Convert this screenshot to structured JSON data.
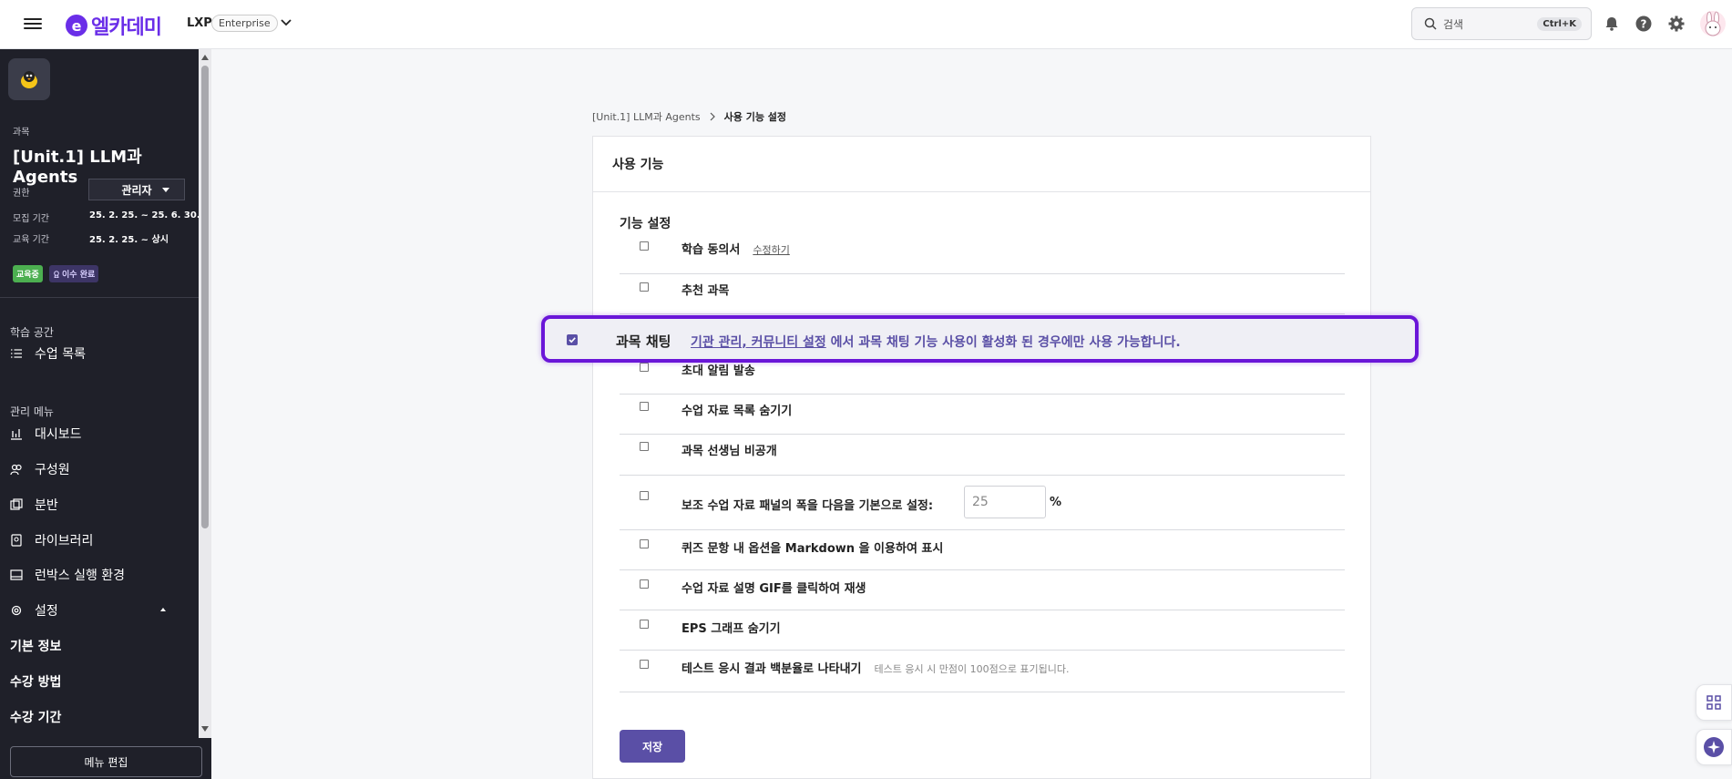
{
  "header": {
    "logo_text": "엘카데미",
    "logo_mark": "e",
    "product": "LXP",
    "edition": "Enterprise",
    "search_placeholder": "검색",
    "search_shortcut": "Ctrl+K",
    "icons": [
      "menu-icon",
      "chevron-down-icon",
      "search-icon",
      "bell-icon",
      "help-icon",
      "gear-icon",
      "user-avatar"
    ]
  },
  "sidebar": {
    "course_label": "과목",
    "course_title": "[Unit.1] LLM과 Agents",
    "role_label": "권한",
    "role_value": "관리자",
    "recruit_label": "모집 기간",
    "recruit_value": "25. 2. 25. ~ 25. 6. 30.",
    "edu_label": "교육 기간",
    "edu_value": "25. 2. 25. ~ 상시",
    "badge_status": "교육중",
    "badge_complete": "이수 완료",
    "section_learning": "학습 공간",
    "learning_items": [
      {
        "label": "수업 목록",
        "icon": "list-icon"
      }
    ],
    "section_admin": "관리 메뉴",
    "admin_items": [
      {
        "label": "대시보드",
        "icon": "chart-icon"
      },
      {
        "label": "구성원",
        "icon": "members-icon"
      },
      {
        "label": "분반",
        "icon": "class-icon"
      },
      {
        "label": "라이브러리",
        "icon": "library-icon"
      },
      {
        "label": "런박스 실행 환경",
        "icon": "runbox-icon"
      },
      {
        "label": "설정",
        "icon": "gear-icon"
      }
    ],
    "settings_sub": [
      "기본 정보",
      "수강 방법",
      "수강 기간"
    ],
    "menu_edit": "메뉴 편집"
  },
  "breadcrumb": {
    "parent": "[Unit.1] LLM과 Agents",
    "current": "사용 기능 설정"
  },
  "card": {
    "title": "사용 기능",
    "section_title": "기능 설정",
    "rows": [
      {
        "label": "학습 동의서",
        "link": "수정하기",
        "checked": false
      },
      {
        "label": "추천 과목",
        "checked": false
      },
      {
        "label": "초대 알림 발송",
        "checked": false
      },
      {
        "label": "수업 자료 목록 숨기기",
        "checked": false
      },
      {
        "label": "과목 선생님 비공개",
        "checked": false
      },
      {
        "label": "보조 수업 자료 패널의 폭을 다음을 기본으로 설정:",
        "input_value": "25",
        "unit": "%",
        "checked": false
      },
      {
        "label": "퀴즈 문항 내 옵션을 Markdown 을 이용하여 표시",
        "checked": false
      },
      {
        "label": "수업 자료 설명 GIF를 클릭하여 재생",
        "checked": false
      },
      {
        "label": "EPS 그래프 숨기기",
        "checked": false
      },
      {
        "label": "테스트 응시 결과 백분율로 나타내기",
        "hint": "테스트 응시 시 만점이 100점으로 표기됩니다.",
        "checked": false
      }
    ],
    "save_label": "저장"
  },
  "highlight": {
    "label": "과목 채팅",
    "link": "기관 관리, 커뮤니티 설정",
    "text": " 에서 과목 채팅 기능 사용이 활성화 된 경우에만 사용 가능합니다.",
    "checked": true
  },
  "colors": {
    "brand": "#6a2ee8",
    "sidebar_bg": "#1f2029",
    "accent": "#5a4fa6",
    "highlight_border": "#6a16d8",
    "badge_green": "#4caf50"
  }
}
